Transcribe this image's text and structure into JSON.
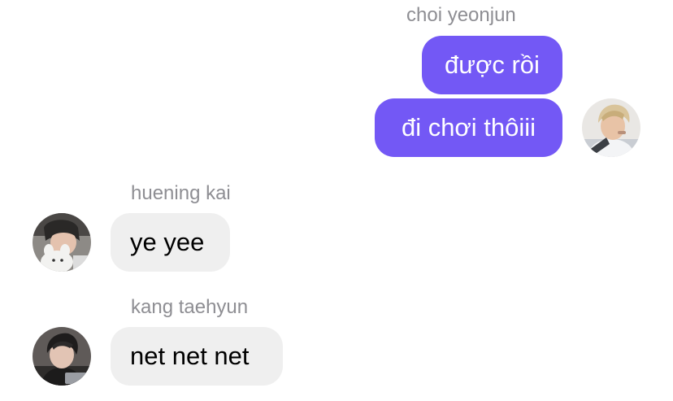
{
  "conversation": {
    "groups": [
      {
        "sender": "choi yeonjun",
        "direction": "outgoing",
        "messages": [
          "được rồi",
          "đi chơi thôiii"
        ],
        "avatar_icon": "user-avatar-blonde-icon"
      },
      {
        "sender": "huening kai",
        "direction": "incoming",
        "messages": [
          "ye yee"
        ],
        "avatar_icon": "user-avatar-plush-icon"
      },
      {
        "sender": "kang taehyun",
        "direction": "incoming",
        "messages": [
          "net net net"
        ],
        "avatar_icon": "user-avatar-dark-hair-icon"
      }
    ]
  },
  "colors": {
    "outgoing_bubble": "#7358f5",
    "incoming_bubble": "#efefef",
    "sender_name": "#8e8e93"
  }
}
